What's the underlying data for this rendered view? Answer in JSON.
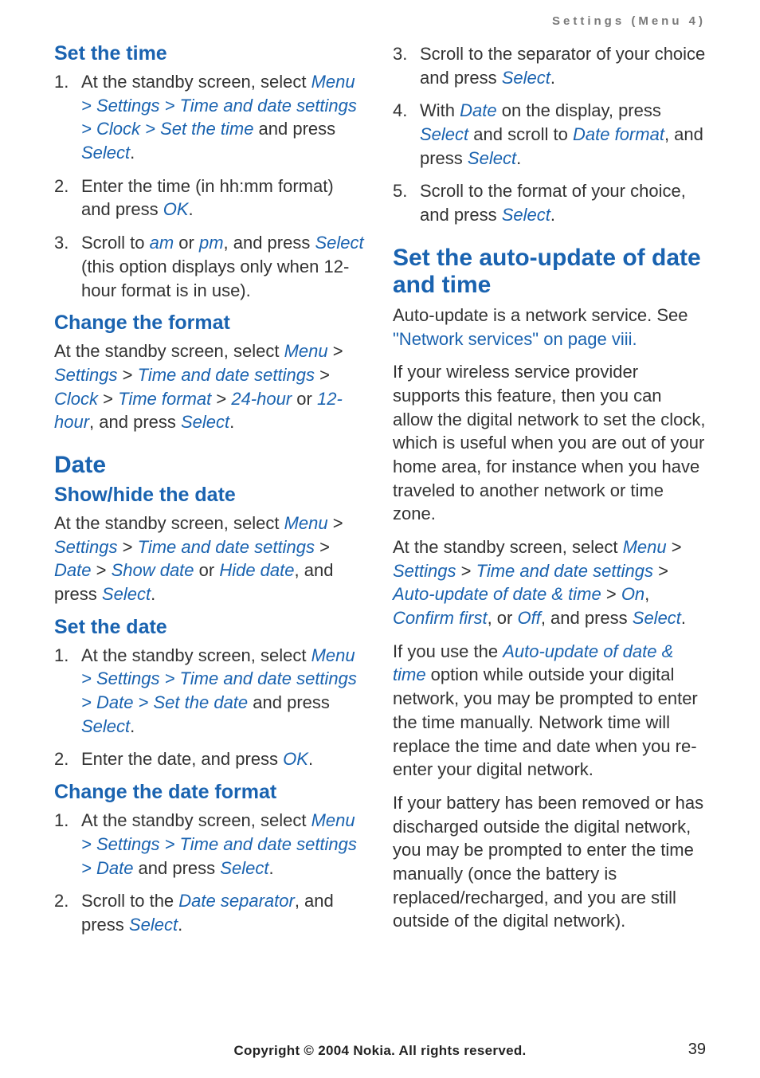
{
  "running_head": "Settings (Menu 4)",
  "left": {
    "set_time": {
      "heading": "Set the time",
      "items": [
        {
          "n": "1.",
          "pre": "At the standby screen, select ",
          "path": "Menu > Settings > Time and date settings > Clock > Set the time",
          "mid": " and press ",
          "k1": "Select",
          "post": "."
        },
        {
          "n": "2.",
          "pre": "Enter the time (in hh:mm format) and press ",
          "k1": "OK",
          "post": "."
        },
        {
          "n": "3.",
          "pre": "Scroll to ",
          "k1": "am",
          "mid1": " or ",
          "k2": "pm",
          "mid2": ", and press ",
          "k3": "Select",
          "post": " (this option displays only when 12-hour format is in use)."
        }
      ]
    },
    "change_format": {
      "heading": "Change the format",
      "pre": "At the standby screen, select ",
      "k_menu": "Menu",
      "gt1": " > ",
      "k_settings": "Settings",
      "gt2": " > ",
      "k_tds": "Time and date settings",
      "gt3": " > ",
      "k_clock": "Clock",
      "gt4": " > ",
      "k_tf": "Time format",
      "gt5": " > ",
      "k_24": "24-hour",
      "or": " or ",
      "k_12": "12-hour",
      "mid": ", and press ",
      "k_sel": "Select",
      "post": "."
    },
    "date_heading": "Date",
    "show_hide": {
      "heading": "Show/hide the date",
      "pre": "At the standby screen, select ",
      "k_menu": "Menu",
      "gt1": " > ",
      "k_settings": "Settings",
      "gt2": " > ",
      "k_tds": "Time and date settings",
      "gt3": " > ",
      "k_date": "Date",
      "gt4": " > ",
      "k_show": "Show date",
      "or": " or ",
      "k_hide": "Hide date",
      "mid": ", and press ",
      "k_sel": "Select",
      "post": "."
    },
    "set_date": {
      "heading": "Set the date",
      "items": [
        {
          "n": "1.",
          "pre": "At the standby screen, select ",
          "path": "Menu > Settings > Time and date settings > Date > Set the date",
          "mid": " and press ",
          "k1": "Select",
          "post": "."
        },
        {
          "n": "2.",
          "pre": "Enter the date, and press ",
          "k1": "OK",
          "post": "."
        }
      ]
    },
    "change_date_format": {
      "heading": "Change the date format",
      "items": [
        {
          "n": "1.",
          "pre": "At the standby screen, select ",
          "path": "Menu > Settings > Time and date settings > Date",
          "mid": " and press ",
          "k1": "Select",
          "post": "."
        },
        {
          "n": "2.",
          "pre": "Scroll to the ",
          "k1": "Date separator",
          "mid": ", and press ",
          "k2": "Select",
          "post": "."
        }
      ]
    }
  },
  "right": {
    "cont_items": [
      {
        "n": "3.",
        "pre": "Scroll to the separator of your choice and press ",
        "k1": "Select",
        "post": "."
      },
      {
        "n": "4.",
        "pre": "With ",
        "k1": "Date",
        "mid1": " on the display, press ",
        "k2": "Select",
        "mid2": " and scroll to ",
        "k3": "Date format",
        "mid3": ", and press ",
        "k4": "Select",
        "post": "."
      },
      {
        "n": "5.",
        "pre": "Scroll to the format of your choice, and press ",
        "k1": "Select",
        "post": "."
      }
    ],
    "auto": {
      "heading": "Set the auto-update of date and time",
      "p1_pre": "Auto-update is a network service. See ",
      "p1_link": "\"Network services\" on page viii.",
      "p2": "If your wireless service provider supports this feature, then you can allow the digital network to set the clock, which is useful when you are out of your home area, for instance when you have traveled to another network or time zone.",
      "p3_pre": "At the standby screen, select ",
      "p3_menu": "Menu",
      "p3_gt1": " > ",
      "p3_settings": "Settings",
      "p3_gt2": " > ",
      "p3_tds": "Time and date settings",
      "p3_gt3": " > ",
      "p3_auto": "Auto-update of date & time",
      "p3_gt4": " > ",
      "p3_on": "On",
      "p3_c1": ", ",
      "p3_cf": "Confirm first",
      "p3_c2": ", or ",
      "p3_off": "Off",
      "p3_mid": ", and press ",
      "p3_sel": "Select",
      "p3_post": ".",
      "p4_pre": "If you use the ",
      "p4_k": "Auto-update of date & time",
      "p4_post": " option while outside your digital network, you may be prompted to enter the time manually. Network time will replace the time and date when you re-enter your digital network.",
      "p5": "If your battery has been removed or has discharged outside the digital network, you may be prompted to enter the time manually (once the battery is replaced/recharged, and you are still outside of the digital network)."
    }
  },
  "footer": "Copyright © 2004 Nokia. All rights reserved.",
  "page_number": "39"
}
